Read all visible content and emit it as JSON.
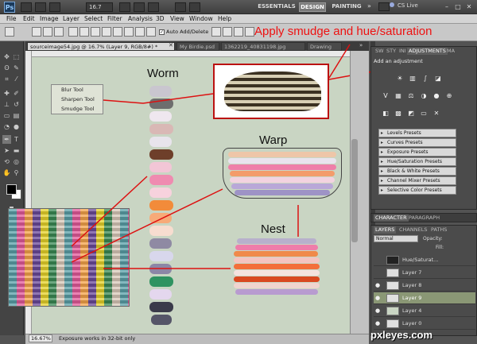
{
  "app": {
    "logo": "Ps",
    "zoom": "16.7",
    "workspaces": [
      "ESSENTIALS",
      "DESIGN",
      "PAINTING"
    ],
    "active_workspace": "DESIGN",
    "cs_live": "CS Live",
    "menu": [
      "File",
      "Edit",
      "Image",
      "Layer",
      "Select",
      "Filter",
      "Analysis",
      "3D",
      "View",
      "Window",
      "Help"
    ]
  },
  "options_bar": {
    "auto_add_delete": "Auto Add/Delete"
  },
  "annotation": "Apply smudge and hue/saturation",
  "document_tabs": [
    "sourceimage54.jpg @ 16.7% (Layer 9, RGB/8#) *",
    "My Birdie.psd",
    "1362219_40831198.jpg",
    "Drawing"
  ],
  "tool_popup": {
    "items": [
      "Blur Tool",
      "Sharpen Tool",
      "Smudge Tool"
    ]
  },
  "canvas_labels": {
    "worm": "Worm",
    "warp": "Warp",
    "nest": "Nest"
  },
  "status": {
    "zoom": "16.67%",
    "message": "Exposure works in 32-bit only"
  },
  "adjustments_panel": {
    "tabs": [
      "SW",
      "STY",
      "INI",
      "ADJUSTMENTS",
      "MA"
    ],
    "active_tab": "ADJUSTMENTS",
    "title": "Add an adjustment",
    "presets": [
      "Levels Presets",
      "Curves Presets",
      "Exposure Presets",
      "Hue/Saturation Presets",
      "Black & White Presets",
      "Channel Mixer Presets",
      "Selective Color Presets"
    ]
  },
  "character_panel": {
    "tabs": [
      "CHARACTER",
      "PARAGRAPH"
    ]
  },
  "layers_panel": {
    "tabs": [
      "LAYERS",
      "CHANNELS",
      "PATHS"
    ],
    "blend_mode": "Normal",
    "opacity_label": "Opacity:",
    "fill_label": "Fill:",
    "layers": [
      {
        "name": "Hue/Saturat...",
        "visible": false,
        "selected": false
      },
      {
        "name": "Layer 7",
        "visible": false,
        "selected": false
      },
      {
        "name": "Layer 8",
        "visible": true,
        "selected": false
      },
      {
        "name": "Layer 9",
        "visible": true,
        "selected": true
      },
      {
        "name": "Layer 4",
        "visible": true,
        "selected": false
      },
      {
        "name": "Layer 0",
        "visible": true,
        "selected": false
      }
    ]
  },
  "watermark": "pxleyes.com",
  "colors": {
    "annotation": "#ee1111",
    "arrow": "#dd1111",
    "selected_layer": "#8a9775"
  }
}
